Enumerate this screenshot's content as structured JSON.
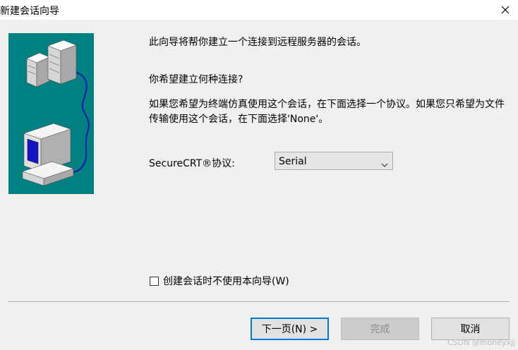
{
  "window": {
    "title": "新建会话向导",
    "close_icon": "close-icon"
  },
  "wizard": {
    "intro": "此向导将帮你建立一个连接到远程服务器的会话。",
    "question": "你希望建立何种连接?",
    "explanation": "如果您希望为终端仿真使用这个会话，在下面选择一个协议。如果您只希望为文件传输使用这个会话，在下面选择'None'。",
    "protocol_label": "SecureCRT®协议:",
    "protocol_value": "Serial",
    "skip_wizard_label": "创建会话时不使用本向导(W)",
    "skip_wizard_checked": false
  },
  "buttons": {
    "next": "下一页(N) >",
    "finish": "完成",
    "cancel": "取消"
  },
  "watermark": "CSDN @moneyxjj",
  "colors": {
    "illustration_bg": "#008080",
    "primary_border": "#0078d7"
  }
}
